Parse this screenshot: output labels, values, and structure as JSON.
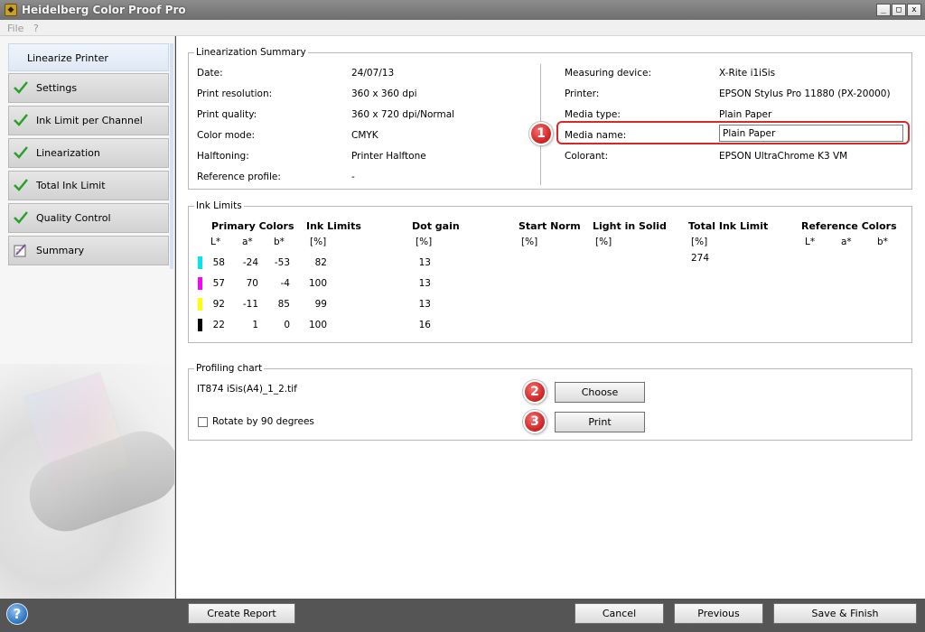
{
  "window": {
    "title": "Heidelberg Color Proof Pro",
    "app_icon": "hcp-logo-icon",
    "buttons": [
      "_",
      "□",
      "x"
    ]
  },
  "menu": {
    "file": "File",
    "help": "?"
  },
  "sidebar": {
    "active": "Linearize Printer",
    "items": [
      {
        "label": "Settings",
        "icon": "check-icon"
      },
      {
        "label": "Ink Limit per Channel",
        "icon": "check-icon"
      },
      {
        "label": "Linearization",
        "icon": "check-icon"
      },
      {
        "label": "Total Ink Limit",
        "icon": "check-icon"
      },
      {
        "label": "Quality Control",
        "icon": "check-icon"
      },
      {
        "label": "Summary",
        "icon": "summary-icon"
      }
    ]
  },
  "summary": {
    "legend": "Linearization Summary",
    "left": [
      {
        "label": "Date:",
        "value": "24/07/13"
      },
      {
        "label": "Print resolution:",
        "value": "360 x 360 dpi"
      },
      {
        "label": "Print quality:",
        "value": "360 x 720 dpi/Normal"
      },
      {
        "label": "Color mode:",
        "value": "CMYK"
      },
      {
        "label": "Halftoning:",
        "value": "Printer Halftone"
      },
      {
        "label": "Reference profile:",
        "value": "-"
      }
    ],
    "right": [
      {
        "label": "Measuring device:",
        "value": "X-Rite i1iSis"
      },
      {
        "label": "Printer:",
        "value": "EPSON Stylus Pro 11880 (PX-20000)"
      },
      {
        "label": "Media type:",
        "value": "Plain Paper"
      },
      {
        "label": "Colorant:",
        "value": "EPSON UltraChrome K3 VM"
      }
    ],
    "media_name_label": "Media name:",
    "media_name_value": "Plain Paper",
    "callout_1": "1"
  },
  "ink_limits": {
    "legend": "Ink Limits",
    "headers": {
      "primary": "Primary Colors",
      "ink_limits": "Ink Limits",
      "dot_gain": "Dot gain",
      "start_norm": "Start Norm",
      "light_in_solid": "Light in Solid",
      "total_ink_limit": "Total Ink Limit",
      "reference_colors": "Reference Colors"
    },
    "sub": {
      "L": "L*",
      "a": "a*",
      "b": "b*",
      "pct": "[%]"
    },
    "total_ink_value": "274",
    "rows": [
      {
        "color": "#00e5ee",
        "L": "58",
        "a": "-24",
        "b": "-53",
        "ink": "82",
        "dot": "13"
      },
      {
        "color": "#ff00ff",
        "L": "57",
        "a": "70",
        "b": "-4",
        "ink": "100",
        "dot": "13"
      },
      {
        "color": "#ffff00",
        "L": "92",
        "a": "-11",
        "b": "85",
        "ink": "99",
        "dot": "13"
      },
      {
        "color": "#000000",
        "L": "22",
        "a": "1",
        "b": "0",
        "ink": "100",
        "dot": "16"
      }
    ]
  },
  "profiling": {
    "legend": "Profiling chart",
    "file": "IT874 iSis(A4)_1_2.tif",
    "choose": "Choose",
    "print": "Print",
    "rotate_label": "Rotate by 90 degrees",
    "callout_2": "2",
    "callout_3": "3"
  },
  "footer": {
    "help": "?",
    "create_report": "Create Report",
    "cancel": "Cancel",
    "previous": "Previous",
    "save_finish": "Save & Finish"
  }
}
